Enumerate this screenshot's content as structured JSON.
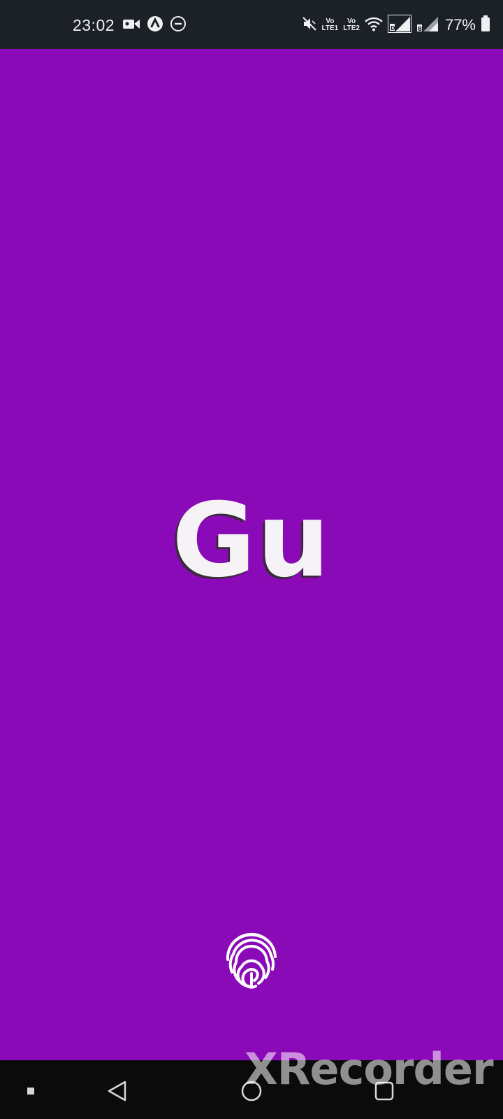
{
  "status_bar": {
    "time": "23:02",
    "volte1": {
      "top": "Vo",
      "bottom": "LTE1"
    },
    "volte2": {
      "top": "Vo",
      "bottom": "LTE2"
    },
    "battery_percent": "77%",
    "icons": [
      "video-camera-icon",
      "vpn-icon",
      "do-not-disturb-icon",
      "mute-icon",
      "wifi-icon",
      "signal-sim1-icon",
      "signal-sim2-icon",
      "battery-icon"
    ]
  },
  "splash": {
    "logo_text": "Gu",
    "background_color": "#8a0ab8"
  },
  "fingerprint": {
    "icon": "fingerprint-icon"
  },
  "nav_bar": {
    "buttons": [
      "recent-apps-icon",
      "back-icon",
      "home-icon",
      "overview-icon"
    ]
  },
  "watermark": {
    "text": "XRecorder"
  }
}
